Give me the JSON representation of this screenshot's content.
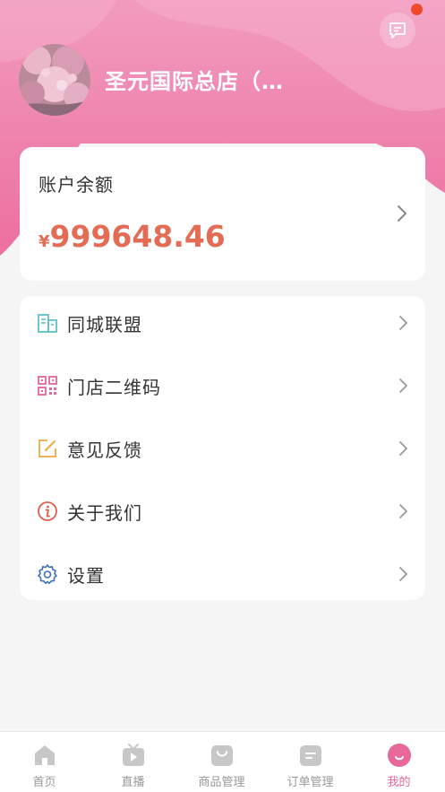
{
  "header": {
    "store_name": "圣元国际总店（…",
    "has_unread_messages": true
  },
  "balance": {
    "title": "账户余额",
    "currency_symbol": "¥",
    "amount_integer": "999648",
    "amount_decimal": ".46"
  },
  "menu": {
    "items": [
      {
        "label": "同城联盟",
        "icon": "building-icon"
      },
      {
        "label": "门店二维码",
        "icon": "qr-code-icon"
      },
      {
        "label": "意见反馈",
        "icon": "edit-icon"
      },
      {
        "label": "关于我们",
        "icon": "info-icon"
      },
      {
        "label": "设置",
        "icon": "gear-icon"
      }
    ]
  },
  "tabbar": {
    "items": [
      {
        "label": "首页",
        "icon": "home-icon"
      },
      {
        "label": "直播",
        "icon": "tv-icon"
      },
      {
        "label": "商品管理",
        "icon": "shopping-bag-icon"
      },
      {
        "label": "订单管理",
        "icon": "order-icon"
      },
      {
        "label": "我的",
        "icon": "profile-icon"
      }
    ],
    "active_index": 4
  },
  "colors": {
    "header_pink": "#ef7fab",
    "amount_red": "#e46c55",
    "tab_active": "#e8689a",
    "tab_inactive": "#c7c7c7"
  }
}
